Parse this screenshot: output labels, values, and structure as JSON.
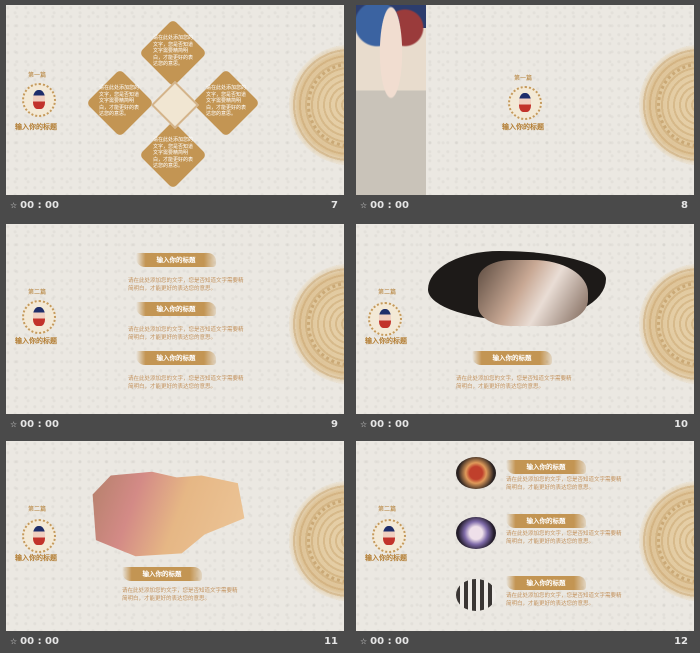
{
  "common": {
    "section_label_1": "第一篇",
    "section_label_2": "第二篇",
    "title_placeholder": "输入你的标题",
    "body_text": "请在此处添加您的文字，您是否知道文字需要精简明白，才能更好的表达您的意思。",
    "diamond_text": "请在此处添加您的文字，您是否知道文字需要精简明白，才能更好的表达您的意思。",
    "time": "00 : 00",
    "icons": {
      "time_glyph": "star-icon"
    }
  },
  "slides": [
    {
      "number": "7"
    },
    {
      "number": "8"
    },
    {
      "number": "9"
    },
    {
      "number": "10"
    },
    {
      "number": "11"
    },
    {
      "number": "12"
    }
  ],
  "colors": {
    "accent": "#c39553",
    "background": "#ebe8e2",
    "frame": "#4a4a4a"
  }
}
